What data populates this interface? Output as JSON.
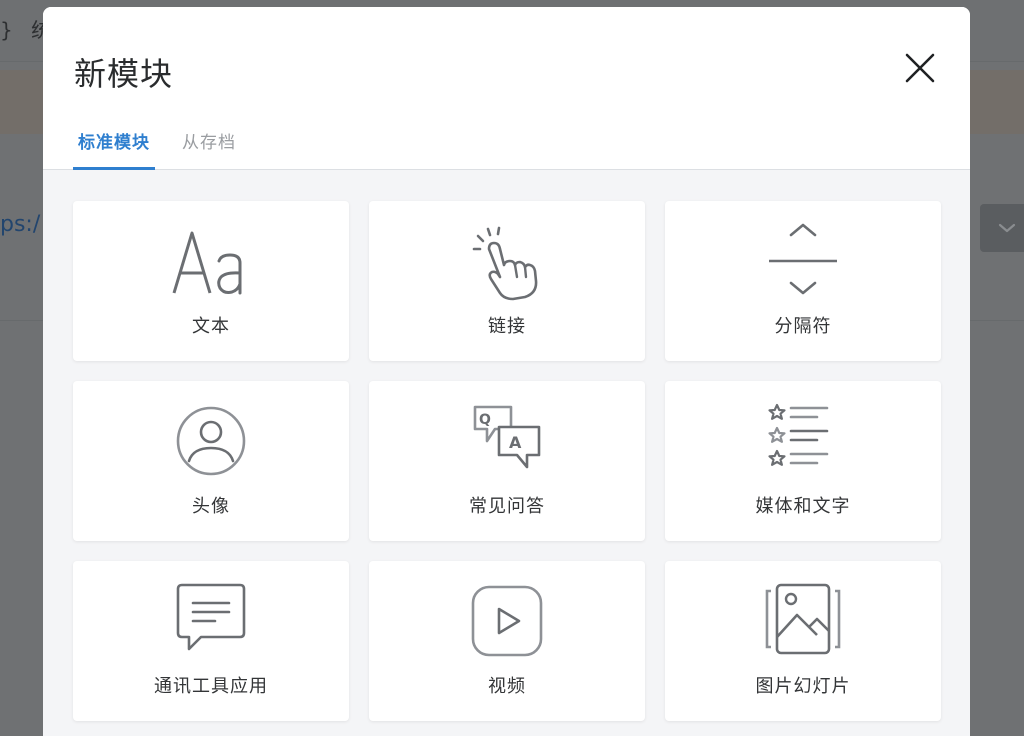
{
  "background": {
    "topbar_text": "}  统",
    "link_text": "ps:/"
  },
  "modal": {
    "title": "新模块",
    "tabs": [
      {
        "label": "标准模块",
        "active": true
      },
      {
        "label": "从存档",
        "active": false
      }
    ],
    "blocks": [
      {
        "label": "文本",
        "icon": "text-icon"
      },
      {
        "label": "链接",
        "icon": "pointer-hand-icon"
      },
      {
        "label": "分隔符",
        "icon": "divider-icon"
      },
      {
        "label": "头像",
        "icon": "avatar-icon"
      },
      {
        "label": "常见问答",
        "icon": "faq-icon"
      },
      {
        "label": "媒体和文字",
        "icon": "media-text-icon"
      },
      {
        "label": "通讯工具应用",
        "icon": "messenger-icon"
      },
      {
        "label": "视频",
        "icon": "video-icon"
      },
      {
        "label": "图片幻灯片",
        "icon": "slideshow-icon"
      }
    ]
  },
  "colors": {
    "accent": "#2f7fcf",
    "icon": "#6b6e72",
    "overlay": "#6f7173"
  }
}
